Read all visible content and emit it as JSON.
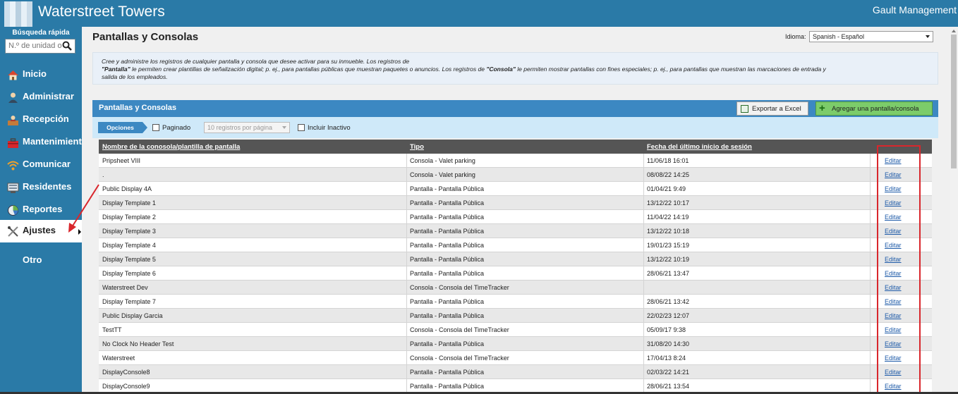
{
  "app": {
    "title": "Waterstreet Towers",
    "user": "Gault Management"
  },
  "sidebar": {
    "quick_search_label": "Búsqueda rápida",
    "quick_search_placeholder": "N.º de unidad o",
    "items": [
      {
        "label": "Inicio",
        "icon": "home-icon"
      },
      {
        "label": "Administrar",
        "icon": "user-admin-icon"
      },
      {
        "label": "Recepción",
        "icon": "reception-icon"
      },
      {
        "label": "Mantenimiento",
        "icon": "toolbox-icon"
      },
      {
        "label": "Comunicar",
        "icon": "wifi-icon"
      },
      {
        "label": "Residentes",
        "icon": "residents-icon"
      },
      {
        "label": "Reportes",
        "icon": "pie-chart-icon"
      },
      {
        "label": "Ajustes",
        "icon": "tools-icon",
        "active": true
      },
      {
        "label": "Otro"
      }
    ]
  },
  "page": {
    "title": "Pantallas y Consolas",
    "language_label": "Idioma:",
    "language_value": "Spanish - Español",
    "info_line1": "Cree y administre los registros de cualquier pantalla y consola que desee activar para su inmueble. Los registros de",
    "info_line2_b1": "\"Pantalla\"",
    "info_line2_t1": " le permiten crear plantillas de señalización digital; p. ej., para pantallas públicas que muestran paquetes o anuncios. Los registros de ",
    "info_line2_b2": "\"Consola\"",
    "info_line2_t2": " le permiten mostrar pantallas con fines especiales; p. ej., para pantallas que muestran las marcaciones de entrada y",
    "info_line3": "salida de los empleados."
  },
  "panel": {
    "title": "Pantallas y Consolas",
    "export_label": "Exportar a Excel",
    "add_label": "Agregar una pantalla/consola",
    "options_label": "Opciones",
    "paged_label": "Paginado",
    "per_page_value": "10 registros por página",
    "include_inactive_label": "Incluir Inactivo"
  },
  "table": {
    "columns": [
      "Nombre de la conosola/plantilla de pantalla",
      "Tipo",
      "Fecha del último inicio de sesión",
      ""
    ],
    "edit_label": "Editar",
    "rows": [
      {
        "name": "Pripsheet VIII",
        "type": "Consola - Valet parking",
        "date": "11/06/18 16:01"
      },
      {
        "name": ".",
        "type": "Consola - Valet parking",
        "date": "08/08/22 14:25"
      },
      {
        "name": "Public Display 4A",
        "type": "Pantalla - Pantalla Pública",
        "date": "01/04/21 9:49"
      },
      {
        "name": "Display Template 1",
        "type": "Pantalla - Pantalla Pública",
        "date": "13/12/22 10:17"
      },
      {
        "name": "Display Template 2",
        "type": "Pantalla - Pantalla Pública",
        "date": "11/04/22 14:19"
      },
      {
        "name": "Display Template 3",
        "type": "Pantalla - Pantalla Pública",
        "date": "13/12/22 10:18"
      },
      {
        "name": "Display Template 4",
        "type": "Pantalla - Pantalla Pública",
        "date": "19/01/23 15:19"
      },
      {
        "name": "Display Template 5",
        "type": "Pantalla - Pantalla Pública",
        "date": "13/12/22 10:19"
      },
      {
        "name": "Display Template 6",
        "type": "Pantalla - Pantalla Pública",
        "date": "28/06/21 13:47"
      },
      {
        "name": "Waterstreet Dev",
        "type": "Consola - Consola del TimeTracker",
        "date": ""
      },
      {
        "name": "Display Template 7",
        "type": "Pantalla - Pantalla Pública",
        "date": "28/06/21 13:42"
      },
      {
        "name": "Public Display Garcia",
        "type": "Pantalla - Pantalla Pública",
        "date": "22/02/23 12:07"
      },
      {
        "name": "TestTT",
        "type": "Consola - Consola del TimeTracker",
        "date": "05/09/17 9:38"
      },
      {
        "name": "No Clock No Header Test",
        "type": "Pantalla - Pantalla Pública",
        "date": "31/08/20 14:30"
      },
      {
        "name": "Waterstreet",
        "type": "Consola - Consola del TimeTracker",
        "date": "17/04/13 8:24"
      },
      {
        "name": "DisplayConsole8",
        "type": "Pantalla - Pantalla Pública",
        "date": "02/03/22 14:21"
      },
      {
        "name": "DisplayConsole9",
        "type": "Pantalla - Pantalla Pública",
        "date": "28/06/21 13:54"
      }
    ]
  },
  "colors": {
    "brand": "#2a7aa7",
    "panel_header": "#3c88c2",
    "highlight": "#d9262c"
  }
}
